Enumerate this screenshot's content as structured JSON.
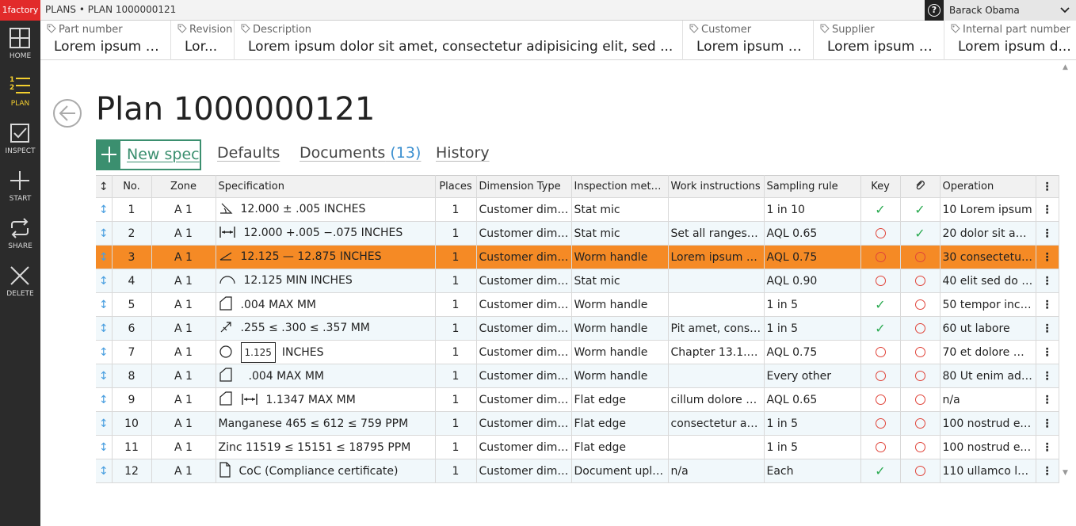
{
  "brand": "1factory",
  "sidebar": [
    {
      "label": "HOME",
      "icon": "grid-icon"
    },
    {
      "label": "PLAN",
      "icon": "numbered-list-icon",
      "active": true
    },
    {
      "label": "INSPECT",
      "icon": "checkbox-icon"
    },
    {
      "label": "START",
      "icon": "plus-icon"
    },
    {
      "label": "SHARE",
      "icon": "share-icon"
    },
    {
      "label": "DELETE",
      "icon": "close-icon"
    }
  ],
  "breadcrumb": "PLANS • PLAN 1000000121",
  "help_glyph": "?",
  "user": "Barack Obama",
  "fields": [
    {
      "label": "Part number",
      "value": "Lorem ipsum d..."
    },
    {
      "label": "Revision",
      "value": "Lor..."
    },
    {
      "label": "Description",
      "value": "Lorem ipsum dolor sit amet, consectetur adipisicing elit, sed ..."
    },
    {
      "label": "Customer",
      "value": "Lorem ipsum d..."
    },
    {
      "label": "Supplier",
      "value": "Lorem ipsum d..."
    },
    {
      "label": "Internal part number",
      "value": "Lorem ipsum d..."
    }
  ],
  "title": "Plan 1000000121",
  "tabs": {
    "new_spec": "New spec",
    "defaults": "Defaults",
    "documents": "Documents",
    "documents_count": "(13)",
    "history": "History"
  },
  "columns": [
    "No.",
    "Zone",
    "Specification",
    "Places",
    "Dimension Type",
    "Inspection method",
    "Work instructions",
    "Sampling rule",
    "Key",
    "",
    "Operation"
  ],
  "rows": [
    {
      "no": "1",
      "zone": "A 1",
      "symbol": "flatness-angle",
      "spec": "12.000 ± .005  INCHES",
      "places": "1",
      "dim": "Customer dime...",
      "method": "Stat mic",
      "work": "",
      "sampling": "1 in 10",
      "key": "ok",
      "attach": "ok",
      "op": "10 Lorem ipsum"
    },
    {
      "no": "2",
      "zone": "A 1",
      "symbol": "width",
      "spec": "12.000 +.005 −.075  INCHES",
      "places": "1",
      "dim": "Customer dime...",
      "method": "Stat mic",
      "work": "Set all ranges to...",
      "sampling": "AQL 0.65",
      "key": "no",
      "attach": "ok",
      "op": "20 dolor sit amet"
    },
    {
      "no": "3",
      "zone": "A 1",
      "symbol": "angle",
      "spec": "12.125 — 12.875  INCHES",
      "places": "1",
      "dim": "Customer dime...",
      "method": "Worm handle",
      "work": "Lorem ipsum do...",
      "sampling": "AQL 0.75",
      "key": "no",
      "attach": "no",
      "op": "30 consectetur ...",
      "selected": true
    },
    {
      "no": "4",
      "zone": "A 1",
      "symbol": "arc",
      "spec": "12.125 MIN  INCHES",
      "places": "1",
      "dim": "Customer dime...",
      "method": "Stat mic",
      "work": "",
      "sampling": "AQL 0.90",
      "key": "no",
      "attach": "no",
      "op": "40 elit sed do ei..."
    },
    {
      "no": "5",
      "zone": "A 1",
      "symbol": "chamfer",
      "spec": ".004 MAX  MM",
      "places": "1",
      "dim": "Customer dime...",
      "method": "Worm handle",
      "work": "",
      "sampling": "1 in 5",
      "key": "ok",
      "attach": "no",
      "op": "50 tempor incid..."
    },
    {
      "no": "6",
      "zone": "A 1",
      "symbol": "runout",
      "spec": ".255 ≤ .300 ≤ .357  MM",
      "places": "1",
      "dim": "Customer dime...",
      "method": "Worm handle",
      "work": "Pit amet, consec...",
      "sampling": "1 in 5",
      "key": "ok",
      "attach": "no",
      "op": "60 ut labore"
    },
    {
      "no": "7",
      "zone": "A 1",
      "symbol": "circle",
      "boxed": "1.125",
      "spec": "INCHES",
      "places": "1",
      "dim": "Customer dime...",
      "method": "Worm handle",
      "work": "Chapter 13.1.45...",
      "sampling": "AQL 0.75",
      "key": "no",
      "attach": "no",
      "op": "70 et dolore ma..."
    },
    {
      "no": "8",
      "zone": "A 1",
      "symbol": "chamfer+flatness",
      "spec": ".004 MAX  MM",
      "places": "1",
      "dim": "Customer dime...",
      "method": "Worm handle",
      "work": "",
      "sampling": "Every other",
      "key": "no",
      "attach": "no",
      "op": "80 Ut enim ad m..."
    },
    {
      "no": "9",
      "zone": "A 1",
      "symbol": "chamfer+width",
      "spec": "1.1347 MAX  MM",
      "places": "1",
      "dim": "Customer dime...",
      "method": "Flat edge",
      "work": "cillum dolore eu...",
      "sampling": "AQL 0.65",
      "key": "no",
      "attach": "no",
      "op": "n/a"
    },
    {
      "no": "10",
      "zone": "A 1",
      "symbol": "",
      "spec": "Manganese   465  ≤  612  ≤  759  PPM",
      "places": "1",
      "dim": "Customer dime...",
      "method": "Flat edge",
      "work": "consectetur adi...",
      "sampling": "1 in 5",
      "key": "no",
      "attach": "no",
      "op": "100 nostrud exe..."
    },
    {
      "no": "11",
      "zone": "A 1",
      "symbol": "",
      "spec": "Zinc   11519  ≤  15151  ≤  18795  PPM",
      "places": "1",
      "dim": "Customer dime...",
      "method": "Flat edge",
      "work": "",
      "sampling": "1 in 5",
      "key": "no",
      "attach": "no",
      "op": "100 nostrud exe..."
    },
    {
      "no": "12",
      "zone": "A 1",
      "symbol": "document",
      "spec": "CoC (Compliance certificate)",
      "places": "1",
      "dim": "Customer dime...",
      "method": "Document uplo...",
      "work": "n/a",
      "sampling": "Each",
      "key": "ok",
      "attach": "no",
      "op": "110 ullamco lab..."
    }
  ],
  "colors": {
    "accent": "#3b8f6f",
    "selected_row": "#f58a25",
    "check": "#2cab52",
    "missing": "#e0443a",
    "brand": "#e22a2a",
    "nav_active": "#f3cf2f",
    "link": "#3a8fd0"
  }
}
